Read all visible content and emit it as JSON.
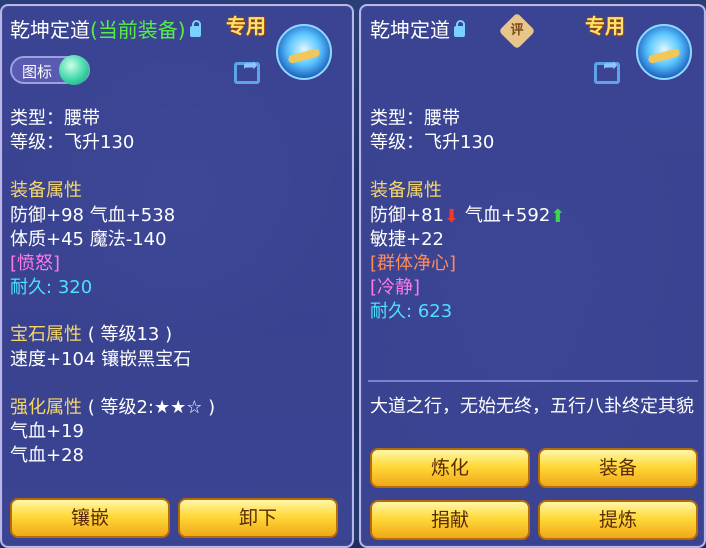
{
  "left": {
    "title_main": "乾坤定道",
    "title_tag": "(当前装备)",
    "exclusive": "专用",
    "icon_toggle": "图标",
    "type_line": "类型：腰带",
    "level_line": "等级：飞升130",
    "attr_header": "装备属性",
    "attr_line1": "防御+98 气血+538",
    "attr_line2": "体质+45 魔法-140",
    "special": "[愤怒]",
    "durability_label": "耐久:",
    "durability_value": "320",
    "gem_header": "宝石属性",
    "gem_level": "( 等级13 )",
    "gem_line": "速度+104 镶嵌黑宝石",
    "enhance_header": "强化属性",
    "enhance_level": "( 等级2:★★☆ )",
    "enhance_line1": "气血+19",
    "enhance_line2": "气血+28",
    "buttons": [
      "镶嵌",
      "卸下"
    ]
  },
  "right": {
    "title_main": "乾坤定道",
    "rating_badge": "评",
    "exclusive": "专用",
    "type_line": "类型：腰带",
    "level_line": "等级：飞升130",
    "attr_header": "装备属性",
    "defense": "防御+81",
    "hp": "气血+592",
    "agility": "敏捷+22",
    "special1": "[群体净心]",
    "special2": "[冷静]",
    "durability_label": "耐久:",
    "durability_value": "623",
    "description": "大道之行，无始无终，五行八卦终定其貌",
    "buttons": [
      "炼化",
      "装备",
      "捐献",
      "提炼"
    ]
  }
}
